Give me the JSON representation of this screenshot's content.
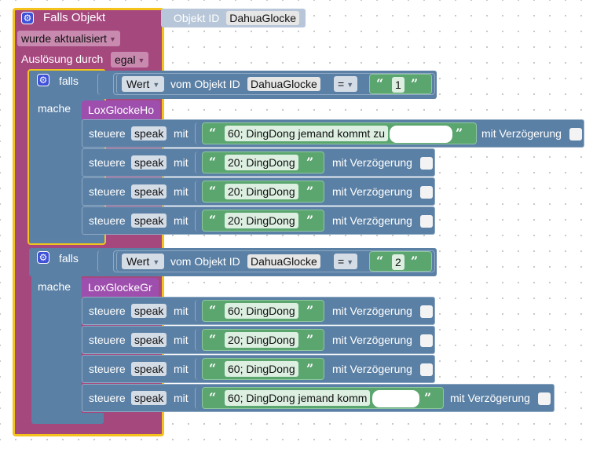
{
  "trigger": {
    "title": "Falls Objekt",
    "objid_label": "Objekt ID",
    "objid_value": "DahuaGlocke",
    "event_dropdown": "wurde aktualisiert",
    "trigger_label": "Auslösung durch",
    "trigger_value": "egal"
  },
  "if_blocks": [
    {
      "falls_label": "falls",
      "mache_label": "mache",
      "condition": {
        "value_dd": "Wert",
        "vom_label": "vom Objekt ID",
        "objid": "DahuaGlocke",
        "operator": "=",
        "compare_value": "1"
      },
      "function": "LoxGlockeHo",
      "commands": [
        {
          "steuere": "steuere",
          "target": "speak",
          "mit": "mit",
          "text": "60; DingDong jemand kommt zu",
          "delay_label": "mit Verzögerung",
          "redacted": true
        },
        {
          "steuere": "steuere",
          "target": "speak",
          "mit": "mit",
          "text": "20; DingDong",
          "delay_label": "mit Verzögerung",
          "redacted": false
        },
        {
          "steuere": "steuere",
          "target": "speak",
          "mit": "mit",
          "text": "20; DingDong",
          "delay_label": "mit Verzögerung",
          "redacted": false
        },
        {
          "steuere": "steuere",
          "target": "speak",
          "mit": "mit",
          "text": "20; DingDong",
          "delay_label": "mit Verzögerung",
          "redacted": false
        }
      ]
    },
    {
      "falls_label": "falls",
      "mache_label": "mache",
      "condition": {
        "value_dd": "Wert",
        "vom_label": "vom Objekt ID",
        "objid": "DahuaGlocke",
        "operator": "=",
        "compare_value": "2"
      },
      "function": "LoxGlockeGr",
      "commands": [
        {
          "steuere": "steuere",
          "target": "speak",
          "mit": "mit",
          "text": "60; DingDong",
          "delay_label": "mit Verzögerung",
          "redacted": false
        },
        {
          "steuere": "steuere",
          "target": "speak",
          "mit": "mit",
          "text": "20; DingDong",
          "delay_label": "mit Verzögerung",
          "redacted": false
        },
        {
          "steuere": "steuere",
          "target": "speak",
          "mit": "mit",
          "text": "60; DingDong",
          "delay_label": "mit Verzögerung",
          "redacted": false
        },
        {
          "steuere": "steuere",
          "target": "speak",
          "mit": "mit",
          "text": "60; DingDong jemand komm",
          "delay_label": "mit Verzögerung",
          "redacted": true
        }
      ]
    }
  ],
  "icons": {
    "gear": "gear-icon",
    "open_quote": "open-quote-icon",
    "close_quote": "close-quote-icon",
    "dropdown_arrow": "chevron-down-icon"
  },
  "colors": {
    "trigger": "#a5487e",
    "highlight": "#f3c31b",
    "logic": "#5b80a5",
    "text": "#5ba56f",
    "function": "#9e4fad"
  }
}
